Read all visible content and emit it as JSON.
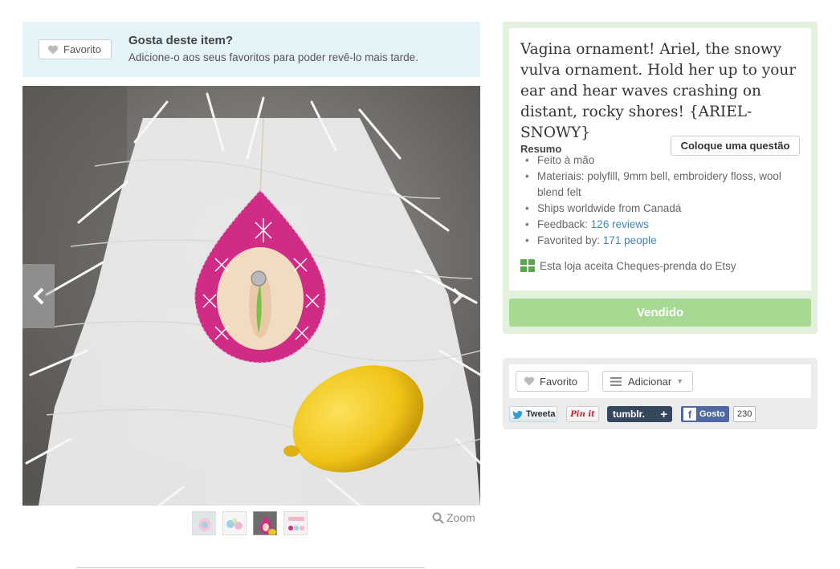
{
  "favorite_banner": {
    "button_label": "Favorito",
    "title": "Gosta deste item?",
    "subtitle": "Adicione-o aos seus favoritos para poder revê-lo mais tarde."
  },
  "gallery": {
    "zoom_label": "Zoom",
    "thumbnail_count": 4
  },
  "product": {
    "title": "Vagina ornament! Ariel, the snowy vulva ornament. Hold her up to your ear and hear waves crashing on distant, rocky shores! {ARIEL-SNOWY}",
    "summary_label": "Resumo",
    "ask_button": "Coloque uma questão",
    "summary": {
      "handmade": "Feito à mão",
      "materials": "Materiais: polyfill, 9mm bell, embroidery floss, wool blend felt",
      "ships": "Ships worldwide from Canadá",
      "feedback_label": "Feedback: ",
      "feedback_link": "126 reviews",
      "favorited_label": "Favorited by: ",
      "favorited_link": "171 people"
    },
    "gift_text": "Esta loja aceita Cheques-prenda do Etsy",
    "sold_button": "Vendido"
  },
  "social": {
    "favorite_label": "Favorito",
    "add_label": "Adicionar",
    "tweet_label": "Tweeta",
    "pin_label": "Pin it",
    "tumblr_label": "tumblr.",
    "tumblr_plus": "+",
    "facebook_label": "Gosto",
    "facebook_count": "230"
  },
  "colors": {
    "banner_bg": "#e4f3f8",
    "panel_bg": "#e3f1dc",
    "sold_button": "#a8d993",
    "link": "#3f86ad"
  }
}
